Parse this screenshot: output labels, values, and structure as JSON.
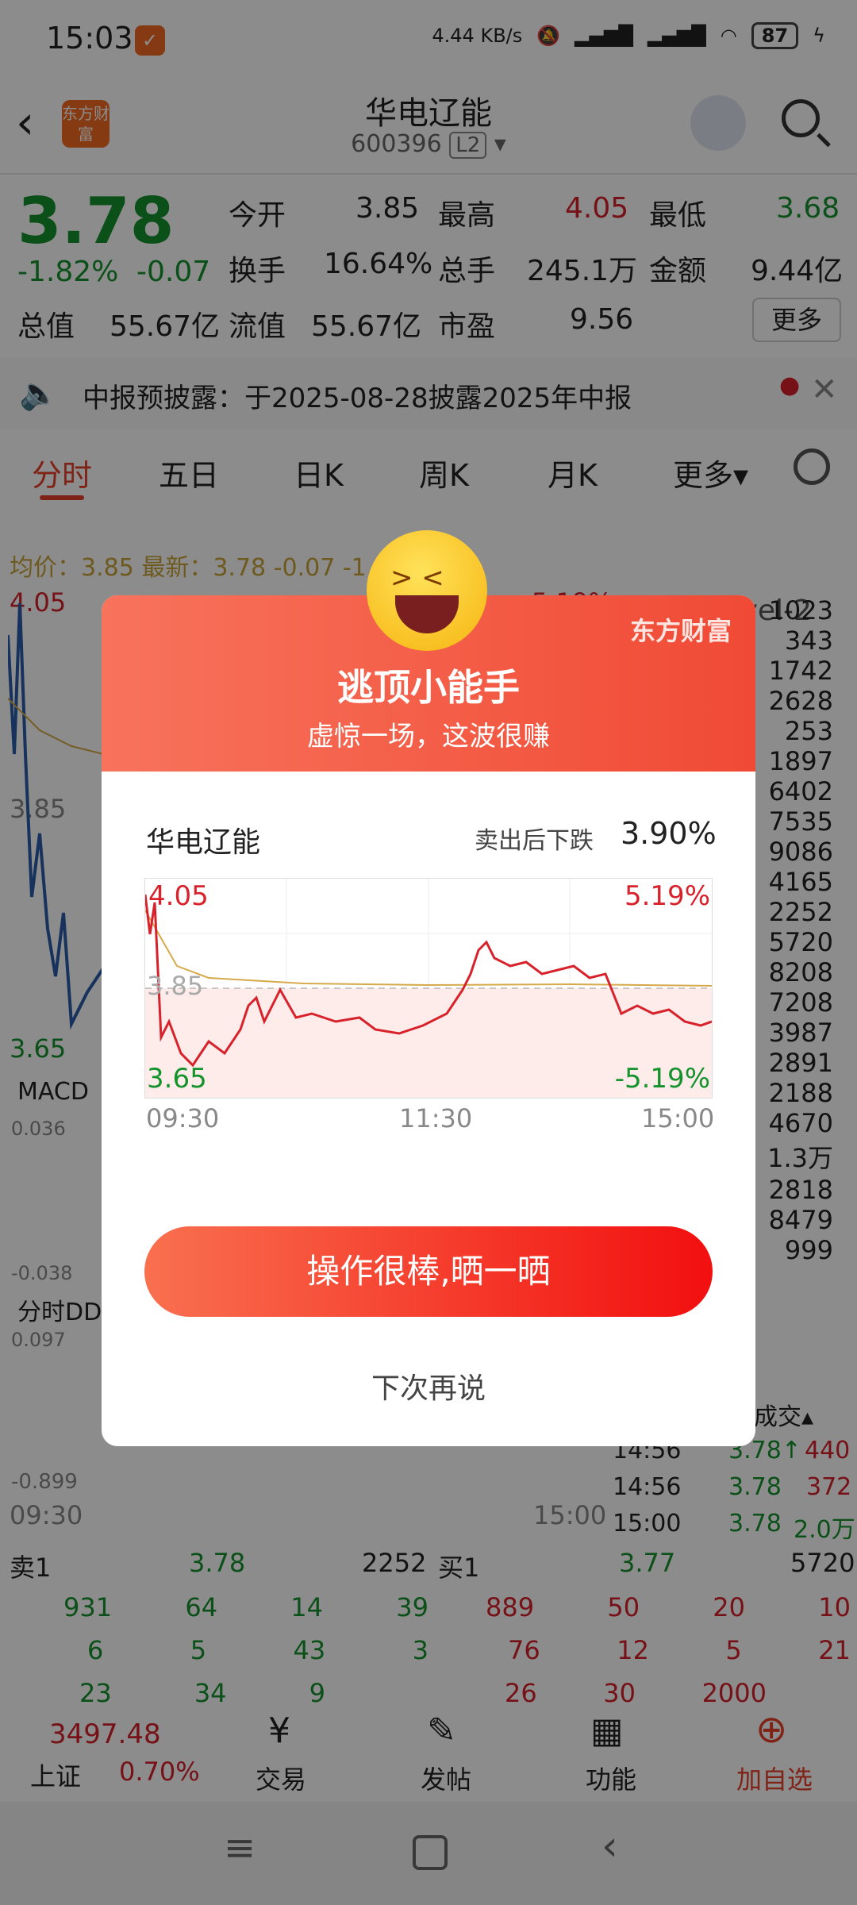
{
  "status": {
    "time": "15:03",
    "net_speed": "4.44 KB/s",
    "battery": "87"
  },
  "header": {
    "back": "‹",
    "logo": "东方财富",
    "title": "华电辽能",
    "code": "600396",
    "level": "L2"
  },
  "quote": {
    "price": "3.78",
    "change_pct": "-1.82%",
    "change": "-0.07",
    "open_label": "今开",
    "open": "3.85",
    "high_label": "最高",
    "high": "4.05",
    "low_label": "最低",
    "low": "3.68",
    "turnover_label": "换手",
    "turnover": "16.64%",
    "volume_label": "总手",
    "volume": "245.1万",
    "amount_label": "金额",
    "amount": "9.44亿",
    "mktcap_label": "总值",
    "mktcap": "55.67亿",
    "float_label": "流值",
    "float": "55.67亿",
    "pe_label": "市盈",
    "pe": "9.56",
    "more": "更多"
  },
  "notice": {
    "text": "中报预披露：于2025-08-28披露2025年中报"
  },
  "tabs": [
    "分时",
    "五日",
    "日K",
    "周K",
    "月K",
    "更多"
  ],
  "chart": {
    "avg_line": "均价：3.85  最新：3.78  -0.07  -1.82%",
    "top": "4.05",
    "top_pct": "5.19%",
    "mid": "3.85",
    "bottom": "3.65",
    "level2": "超级Level-2",
    "macd": "MACD",
    "macd_top": "0.036",
    "macd_bottom": "-0.038",
    "ddx": "分时DDX",
    "ddx_top": "0.097",
    "ddx_bottom": "-0.899",
    "t_start": "09:30",
    "t_end": "15:00"
  },
  "level2_list": [
    "1023",
    "343",
    "1742",
    "2628",
    "253",
    "1897",
    "6402",
    "7535",
    "9086",
    "4165",
    "2252",
    "5720",
    "8208",
    "7208",
    "3987",
    "2891",
    "2188",
    "4670",
    "1.3万",
    "2818",
    "8479",
    "999"
  ],
  "trades": [
    {
      "time": "14:56",
      "price": "3.78↑",
      "vol": "440"
    },
    {
      "time": "14:56",
      "price": "3.78",
      "vol": "372"
    },
    {
      "time": "15:00",
      "price": "3.78",
      "vol": "2.0万"
    }
  ],
  "trade_header": "成交",
  "orderbook": {
    "sell_label": "卖1",
    "sell_price": "3.78",
    "sell_vol": "2252",
    "buy_label": "买1",
    "buy_price": "3.77",
    "buy_vol": "5720",
    "sell_rows": [
      [
        "931",
        "64",
        "14",
        "39"
      ],
      [
        "6",
        "5",
        "43",
        "3"
      ],
      [
        "23",
        "34",
        "9",
        ""
      ]
    ],
    "buy_rows": [
      [
        "889",
        "50",
        "20",
        "10"
      ],
      [
        "76",
        "12",
        "5",
        "21"
      ],
      [
        "26",
        "30",
        "2000",
        ""
      ]
    ]
  },
  "bottom": {
    "index_value": "3497.48",
    "index_name": "上证",
    "index_pct": "0.70%",
    "trade": "交易",
    "post": "发帖",
    "func": "功能",
    "add": "加自选"
  },
  "dialog": {
    "brand": "东方财富",
    "title": "逃顶小能手",
    "subtitle": "虚惊一场，这波很赚",
    "stock": "华电辽能",
    "drop_label": "卖出后下跌",
    "drop_value": "3.90%",
    "chart_top": "4.05",
    "chart_top_pct": "5.19%",
    "chart_mid": "3.85",
    "chart_bottom": "3.65",
    "chart_bottom_pct": "-5.19%",
    "t1": "09:30",
    "t2": "11:30",
    "t3": "15:00",
    "action": "操作很棒,晒一晒",
    "later": "下次再说"
  }
}
